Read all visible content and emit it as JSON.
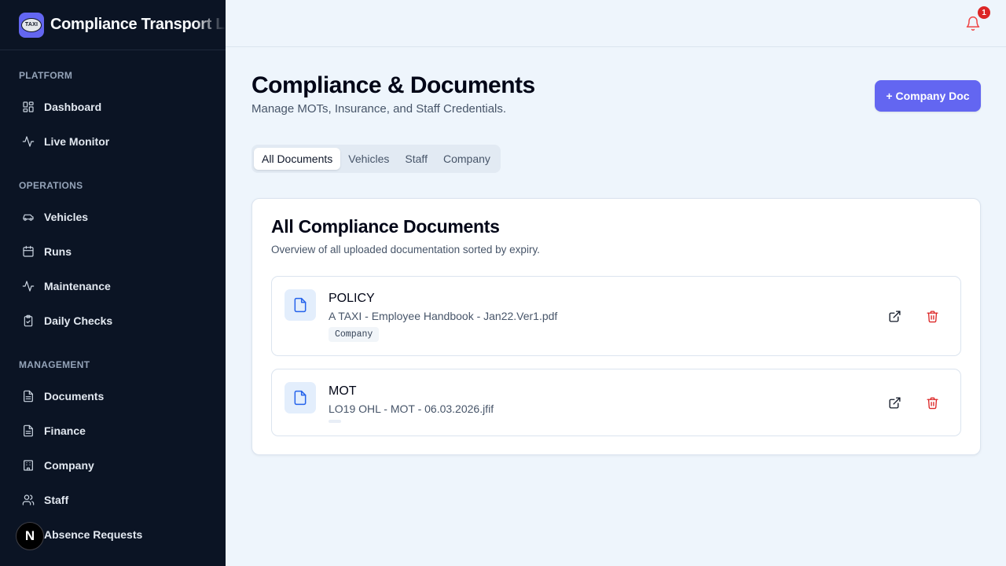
{
  "brand": {
    "name": "Compliance Transport Ltd",
    "logo_text": "TAXI"
  },
  "sidebar": {
    "sections": [
      {
        "label": "PLATFORM",
        "items": [
          {
            "label": "Dashboard",
            "icon": "grid-icon"
          },
          {
            "label": "Live Monitor",
            "icon": "activity-icon"
          }
        ]
      },
      {
        "label": "OPERATIONS",
        "items": [
          {
            "label": "Vehicles",
            "icon": "car-icon"
          },
          {
            "label": "Runs",
            "icon": "calendar-icon"
          },
          {
            "label": "Maintenance",
            "icon": "activity-icon"
          },
          {
            "label": "Daily Checks",
            "icon": "clipboard-check-icon"
          }
        ]
      },
      {
        "label": "MANAGEMENT",
        "items": [
          {
            "label": "Documents",
            "icon": "file-text-icon"
          },
          {
            "label": "Finance",
            "icon": "file-text-icon"
          },
          {
            "label": "Company",
            "icon": "building-icon"
          },
          {
            "label": "Staff",
            "icon": "users-icon"
          },
          {
            "label": "Absence Requests",
            "icon": "calendar-icon"
          }
        ]
      }
    ],
    "dev_badge": "N"
  },
  "topbar": {
    "notification_count": "1"
  },
  "page": {
    "title": "Compliance & Documents",
    "subtitle": "Manage MOTs, Insurance, and Staff Credentials.",
    "add_button": "+ Company Doc"
  },
  "tabs": [
    {
      "label": "All Documents",
      "active": true
    },
    {
      "label": "Vehicles",
      "active": false
    },
    {
      "label": "Staff",
      "active": false
    },
    {
      "label": "Company",
      "active": false
    }
  ],
  "card": {
    "title": "All Compliance Documents",
    "description": "Overview of all uploaded documentation sorted by expiry.",
    "documents": [
      {
        "type": "POLICY",
        "file": "A TAXI - Employee Handbook - Jan22.Ver1.pdf",
        "tag": "Company"
      },
      {
        "type": "MOT",
        "file": "LO19 OHL - MOT - 06.03.2026.jfif",
        "tag": ""
      }
    ]
  },
  "colors": {
    "accent": "#6366f1",
    "sidebar_bg": "#0b1424",
    "danger": "#dc2626",
    "doc_icon": "#2563eb"
  }
}
